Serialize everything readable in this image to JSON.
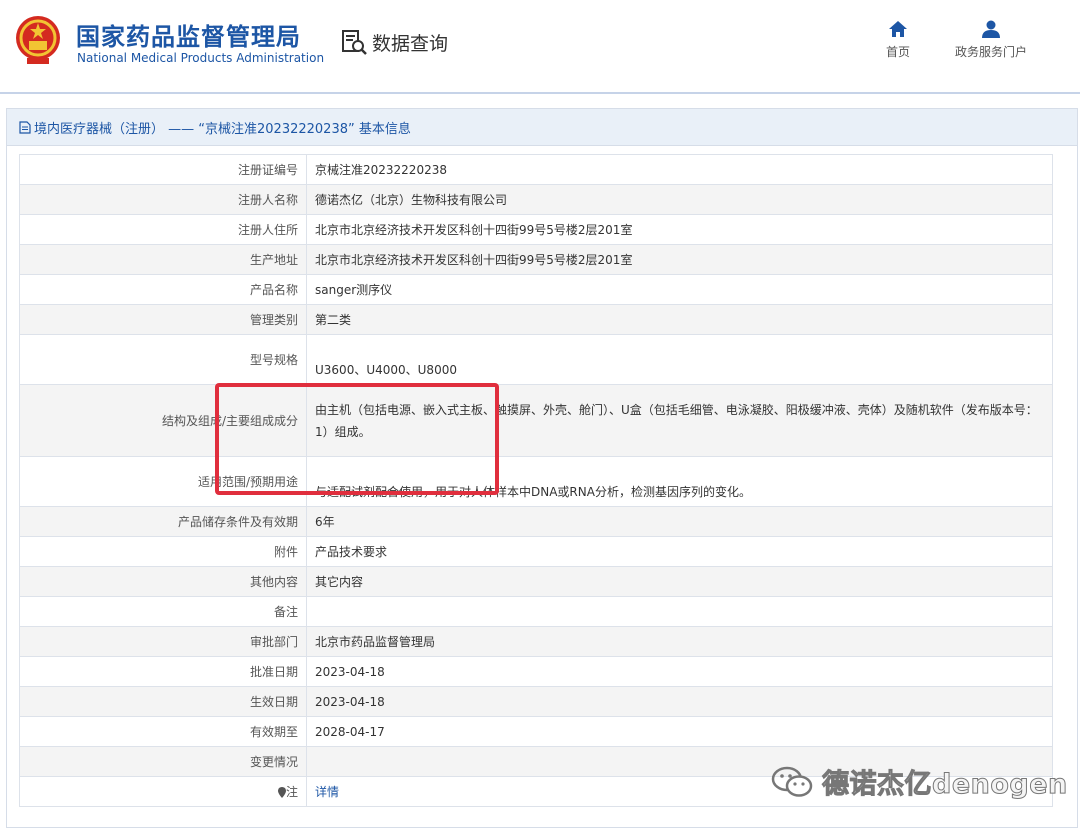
{
  "header": {
    "title_cn": "国家药品监督管理局",
    "title_en": "National Medical Products Administration",
    "query_label": "数据查询",
    "nav": [
      {
        "label": "首页",
        "icon": "home-icon"
      },
      {
        "label": "政务服务门户",
        "icon": "user-icon"
      }
    ]
  },
  "panel": {
    "title": "境内医疗器械（注册） —— “京械注准20232220238” 基本信息"
  },
  "rows": [
    {
      "label": "注册证编号",
      "value": "京械注准20232220238"
    },
    {
      "label": "注册人名称",
      "value": "德诺杰亿（北京）生物科技有限公司"
    },
    {
      "label": "注册人住所",
      "value": "北京市北京经济技术开发区科创十四街99号5号楼2层201室"
    },
    {
      "label": "生产地址",
      "value": "北京市北京经济技术开发区科创十四街99号5号楼2层201室"
    },
    {
      "label": "产品名称",
      "value": "sanger测序仪"
    },
    {
      "label": "管理类别",
      "value": "第二类"
    },
    {
      "label": "型号规格",
      "value": "U3600、U4000、U8000"
    },
    {
      "label": "结构及组成/主要组成成分",
      "value": "由主机（包括电源、嵌入式主板、触摸屏、外壳、舱门）、U盒（包括毛细管、电泳凝胶、阳极缓冲液、壳体）及随机软件（发布版本号：1）组成。"
    },
    {
      "label": "适用范围/预期用途",
      "value": "与适配试剂配合使用，用于对人体样本中DNA或RNA分析，检测基因序列的变化。"
    },
    {
      "label": "产品储存条件及有效期",
      "value": "6年"
    },
    {
      "label": "附件",
      "value": "产品技术要求"
    },
    {
      "label": "其他内容",
      "value": "其它内容"
    },
    {
      "label": "备注",
      "value": ""
    },
    {
      "label": "审批部门",
      "value": "北京市药品监督管理局"
    },
    {
      "label": "批准日期",
      "value": "2023-04-18"
    },
    {
      "label": "生效日期",
      "value": "2023-04-18"
    },
    {
      "label": "有效期至",
      "value": "2028-04-17"
    },
    {
      "label": "变更情况",
      "value": ""
    },
    {
      "label": "注",
      "value": "详情"
    }
  ],
  "watermark": {
    "text": "德诺杰亿denogen",
    "icon": "wechat-icon"
  },
  "colors": {
    "brand": "#1d56a5",
    "highlight": "#e02e3d",
    "header_bg": "#e9f0f8"
  }
}
